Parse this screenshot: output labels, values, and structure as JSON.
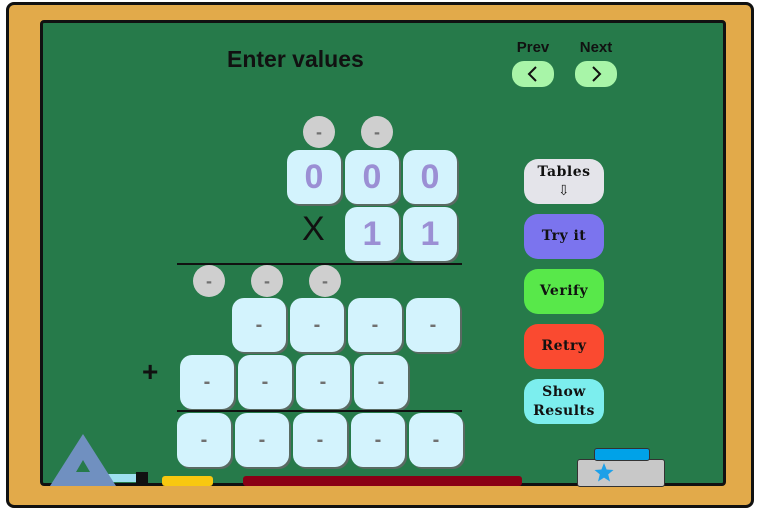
{
  "header": {
    "title": "Enter values",
    "prev_label": "Prev",
    "next_label": "Next",
    "prev_icon": "chevron-left-icon",
    "next_icon": "chevron-right-icon"
  },
  "problem": {
    "carry_top": [
      "-",
      "-"
    ],
    "multiplicand": [
      "0",
      "0",
      "0"
    ],
    "operator_multiply": "X",
    "multiplier": [
      "1",
      "1"
    ],
    "carry_partial": [
      "-",
      "-",
      "-"
    ],
    "partial_product_1": [
      "-",
      "-",
      "-",
      "-"
    ],
    "operator_add": "+",
    "partial_product_2": [
      "-",
      "-",
      "-",
      "-"
    ],
    "result": [
      "-",
      "-",
      "-",
      "-",
      "-"
    ]
  },
  "buttons": {
    "tables": "Tables",
    "tables_icon": "⇩",
    "try_it": "Try it",
    "verify": "Verify",
    "retry": "Retry",
    "show_results_line1": "Show",
    "show_results_line2": "Results"
  },
  "colors": {
    "board": "#267a4a",
    "frame": "#e2aa4a",
    "tables": "#e4e4ea",
    "try_it": "#7b74ee",
    "verify": "#58e84a",
    "retry": "#fa4a30",
    "show_results": "#7ceeee",
    "nav": "#a8f5a8"
  }
}
